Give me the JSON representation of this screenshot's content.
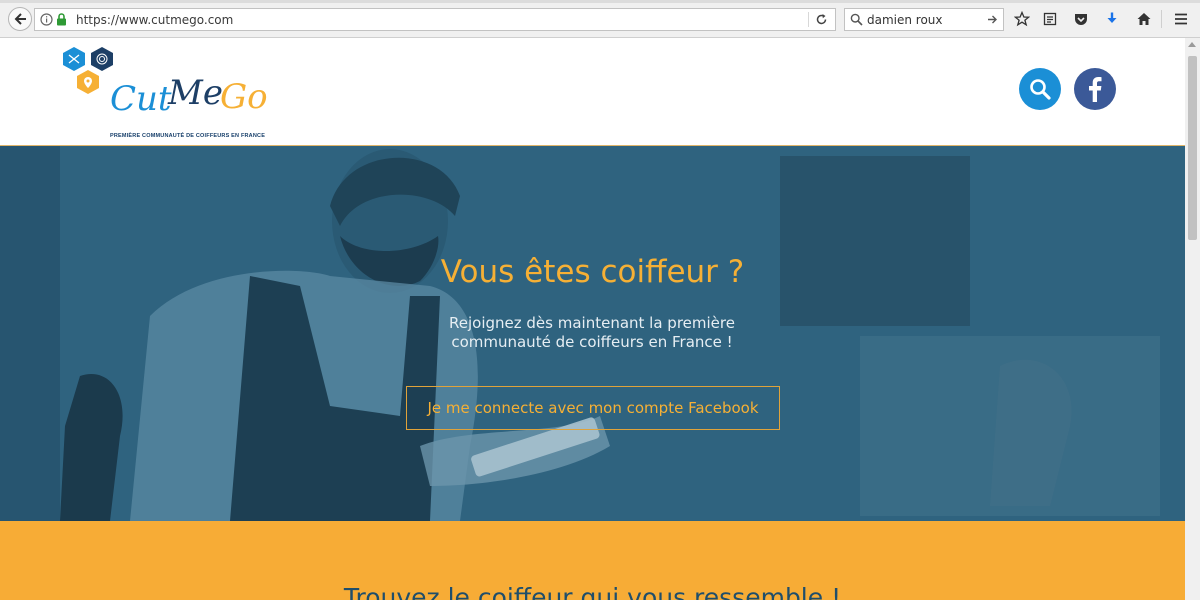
{
  "browser": {
    "url": "https://www.cutmego.com",
    "search_query": "damien roux",
    "icons": [
      "back-arrow-icon",
      "info-icon",
      "lock-icon",
      "reload-icon",
      "magnifier-icon",
      "go-arrow-icon",
      "star-icon",
      "reading-list-icon",
      "pocket-icon",
      "download-icon",
      "home-icon",
      "hamburger-menu-icon"
    ]
  },
  "site": {
    "logo_text": "Cut Me Go",
    "logo_tagline": "PREMIÈRE COMMUNAUTÉ DE COIFFEURS EN FRANCE",
    "header_icons": [
      "search-icon",
      "facebook-icon"
    ]
  },
  "hero": {
    "title": "Vous êtes coiffeur ?",
    "subtitle_line1": "Rejoignez dès maintenant la première",
    "subtitle_line2": "communauté de coiffeurs en France !",
    "button_label": "Je me connecte avec mon compte Facebook"
  },
  "section2": {
    "title": "Trouvez le coiffeur qui vous ressemble !"
  },
  "colors": {
    "accent": "#f6b035",
    "hero_overlay": "#2e617e",
    "facebook": "#3b5998",
    "search": "#1b8fd6",
    "section2_bg": "#f7ac36",
    "section2_text": "#1f4e6b"
  }
}
